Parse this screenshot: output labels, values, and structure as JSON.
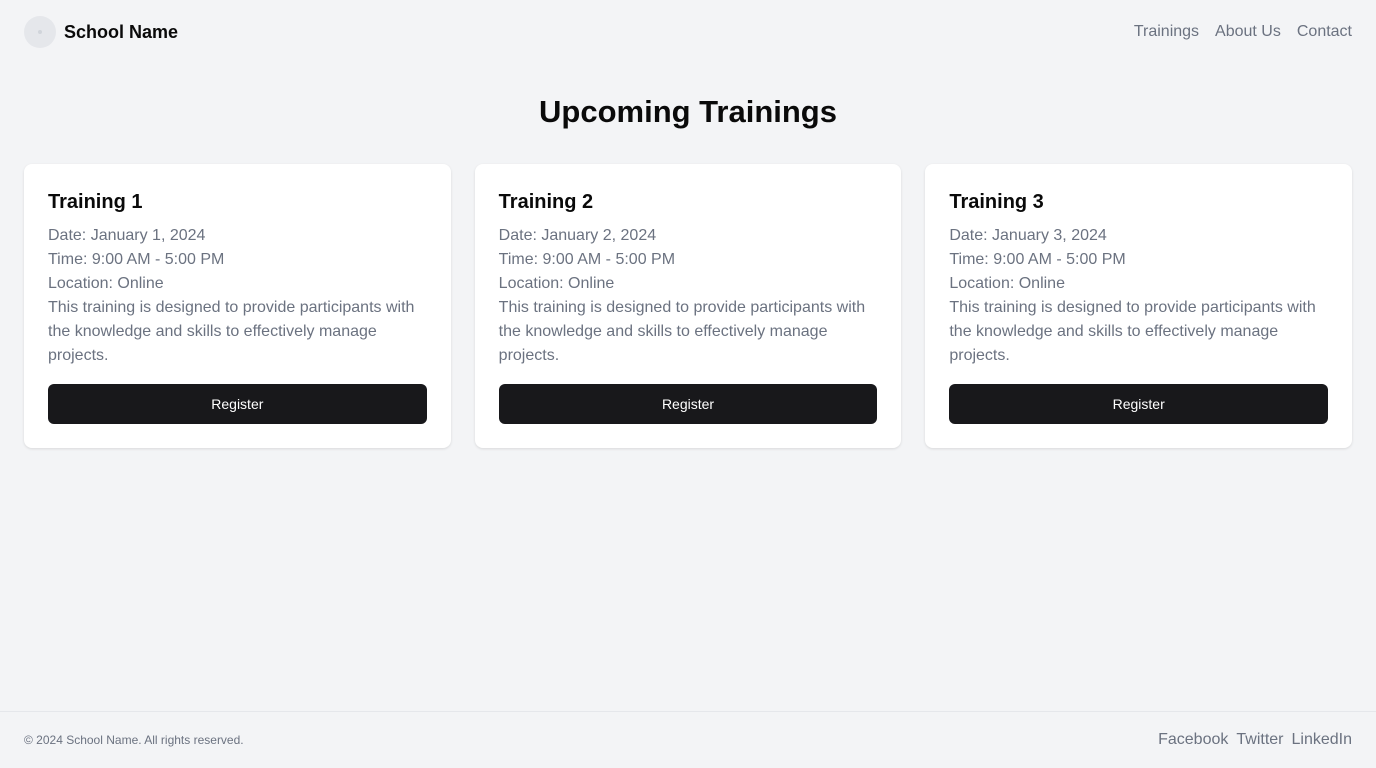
{
  "header": {
    "brand_name": "School Name",
    "nav": [
      "Trainings",
      "About Us",
      "Contact"
    ]
  },
  "main": {
    "title": "Upcoming Trainings",
    "trainings": [
      {
        "title": "Training 1",
        "date": "Date: January 1, 2024",
        "time": "Time: 9:00 AM - 5:00 PM",
        "location": "Location: Online",
        "description": "This training is designed to provide participants with the knowledge and skills to effectively manage projects.",
        "button": "Register"
      },
      {
        "title": "Training 2",
        "date": "Date: January 2, 2024",
        "time": "Time: 9:00 AM - 5:00 PM",
        "location": "Location: Online",
        "description": "This training is designed to provide participants with the knowledge and skills to effectively manage projects.",
        "button": "Register"
      },
      {
        "title": "Training 3",
        "date": "Date: January 3, 2024",
        "time": "Time: 9:00 AM - 5:00 PM",
        "location": "Location: Online",
        "description": "This training is designed to provide participants with the knowledge and skills to effectively manage projects.",
        "button": "Register"
      }
    ]
  },
  "footer": {
    "copyright": "© 2024 School Name. All rights reserved.",
    "social": [
      "Facebook",
      "Twitter",
      "LinkedIn"
    ]
  }
}
